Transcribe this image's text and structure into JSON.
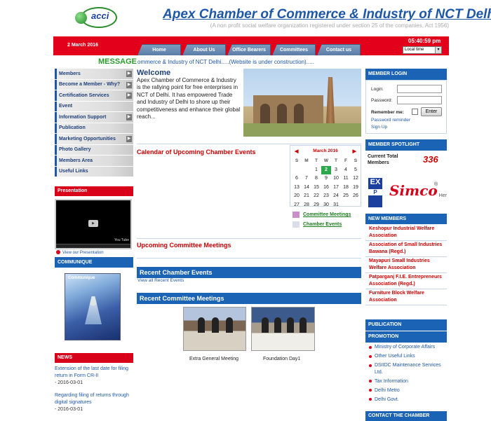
{
  "header": {
    "logo_text": "acci",
    "title": "Apex Chamber of Commerce & Industry of NCT Delhi",
    "subtitle": "(A non profit social welfare organization registered under section 25 of the companies, Act 1956)",
    "date": "2 March 2016",
    "time": "05:40:59 pm",
    "timezone": "Local time"
  },
  "nav": {
    "tabs": [
      "Home",
      "About Us",
      "Office Bearers",
      "Committees",
      "Contact us"
    ]
  },
  "message": {
    "label": "MESSAGE",
    "text": "ommerce & Industry of NCT Delhi.....(Website is under construction)....."
  },
  "sidebar": {
    "items": [
      {
        "label": "Members",
        "arrow": true
      },
      {
        "label": "Become a Member - Why?",
        "arrow": true
      },
      {
        "label": "Certification Services",
        "arrow": true
      },
      {
        "label": "Event",
        "arrow": false
      },
      {
        "label": "Information Support",
        "arrow": true
      },
      {
        "label": "Publication",
        "arrow": false
      },
      {
        "label": "Marketing Opportunities",
        "arrow": true
      },
      {
        "label": "Photo Gallery",
        "arrow": false
      },
      {
        "label": "Members Area",
        "arrow": false
      },
      {
        "label": "Useful Links",
        "arrow": false
      }
    ],
    "presentation_title": "Presentation",
    "view_presentation": "View our Presentation",
    "communique_title": "COMMUNIQUE",
    "communique_cover": "Communique",
    "news_title": "NEWS",
    "news": [
      {
        "text": "Extension of the last date for filing return in Form CR-II",
        "date": " - 2016-03-01"
      },
      {
        "text": "Regarding filing of returns through digital signatures",
        "date": " - 2016-03-01"
      }
    ]
  },
  "welcome": {
    "title": "Welcome",
    "text": "Apex Chamber of Commerce & Industry is the rallying point for free enterprises in NCT of Delhi. It has empowered Trade and Industry of Delhi to shore up their competitiveness and enhance their global reach..."
  },
  "calendar": {
    "heading": "Calendar of Upcoming Chamber Events",
    "month": "March 2016",
    "weekdays": [
      "S",
      "M",
      "T",
      "W",
      "T",
      "F",
      "S"
    ],
    "days": [
      "",
      "",
      "1",
      "2",
      "3",
      "4",
      "5",
      "6",
      "7",
      "8",
      "9",
      "10",
      "11",
      "12",
      "13",
      "14",
      "15",
      "16",
      "17",
      "18",
      "19",
      "20",
      "21",
      "22",
      "23",
      "24",
      "25",
      "26",
      "27",
      "28",
      "29",
      "30",
      "31",
      "",
      ""
    ],
    "today": "2",
    "legend": [
      {
        "label": "Committee Meetings",
        "color": "#c98fc9"
      },
      {
        "label": "Chamber Events",
        "color": "#d9deea"
      }
    ]
  },
  "sections": {
    "upcoming_committee": "Upcoming Committee Meetings",
    "recent_events": "Recent Chamber Events",
    "view_all_events": "View all Recent Events",
    "recent_committee": "Recent Committee Meetings",
    "photos": [
      {
        "caption": "Extra General Meeting"
      },
      {
        "caption": "Foundation Day1"
      }
    ]
  },
  "login": {
    "title": "MEMBER LOGIN",
    "login_label": "Login:",
    "password_label": "Password:",
    "remember_label": "Remember me:",
    "enter_button": "Enter",
    "reminder_link": "Password reminder",
    "signup_link": "Sign Up"
  },
  "spotlight": {
    "title": "MEMBER SPOTLIGHT",
    "count_label": "Current Total Members",
    "count": "336",
    "ad_left": "EX",
    "ad_left_sub": "P",
    "ad_brand": "Simco",
    "ad_reg": "®",
    "ad_suffix": "Her"
  },
  "new_members": {
    "title": "NEW MEMBERS",
    "items": [
      "Keshopur Industrial Welfare Association",
      "Association of Small Industries Bawana (Regd.)",
      "Mayapuri Small Industries Welfare Association",
      "Patparganj F.I.E. Entrepreneurs Association (Regd.)",
      "Furniture Block Welfare Association"
    ]
  },
  "right_sections": {
    "publication": "PUBLICATION",
    "promotion": "PROMOTION",
    "links": [
      "Ministry of Corporate Affairs",
      "Other Useful Links",
      "DSIIDC Maintenance Services Ltd.",
      "Tax Information",
      "Delhi Metro",
      "Delhi Govt."
    ],
    "contact": "CONTACT THE CHAMBER"
  }
}
